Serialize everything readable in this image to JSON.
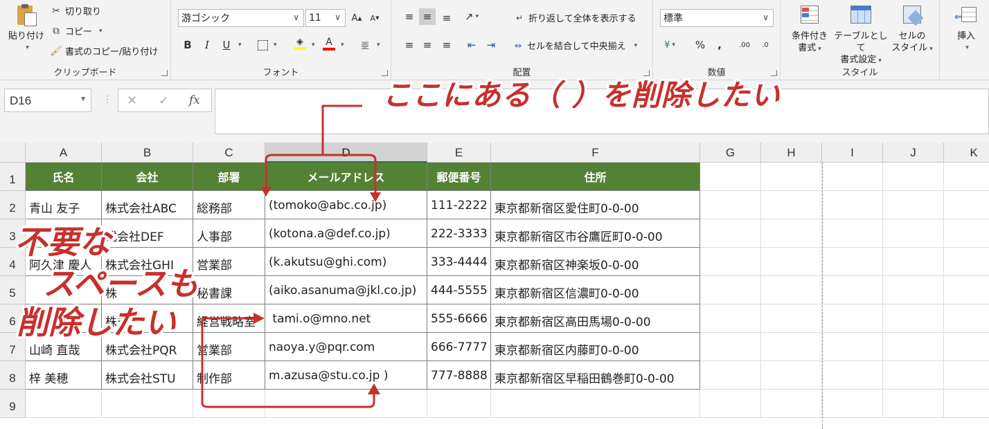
{
  "ribbon": {
    "clipboard": {
      "paste": "貼り付け",
      "cut": "切り取り",
      "copy": "コピー",
      "format_painter": "書式のコピー/貼り付け",
      "label": "クリップボード"
    },
    "font": {
      "name": "游ゴシック",
      "size": "11",
      "label": "フォント"
    },
    "alignment": {
      "wrap_text": "折り返して全体を表示する",
      "merge_center": "セルを結合して中央揃え",
      "label": "配置"
    },
    "number": {
      "format": "標準",
      "label": "数値"
    },
    "styles": {
      "conditional_1": "条件付き",
      "conditional_2": "書式",
      "table_1": "テーブルとして",
      "table_2": "書式設定",
      "cell_1": "セルの",
      "cell_2": "スタイル",
      "label": "スタイル"
    },
    "cells": {
      "insert": "挿入"
    }
  },
  "formula_bar": {
    "name_box": "D16",
    "cancel_glyph": "✕",
    "enter_glyph": "✓",
    "fx": "fx",
    "value": ""
  },
  "columns": [
    "A",
    "B",
    "C",
    "D",
    "E",
    "F",
    "G",
    "H",
    "I",
    "J",
    "K"
  ],
  "rows": [
    "1",
    "2",
    "3",
    "4",
    "5",
    "6",
    "7",
    "8",
    "9"
  ],
  "table": {
    "headers": [
      "氏名",
      "会社",
      "部署",
      "メールアドレス",
      "郵便番号",
      "住所"
    ],
    "rows": [
      [
        "青山 友子",
        "株式会社ABC",
        "総務部",
        "(tomoko@abc.co.jp)",
        "111-2222",
        "東京都新宿区愛住町0-0-00"
      ],
      [
        "",
        "式会社DEF",
        "人事部",
        "(kotona.a@def.co.jp)",
        "222-3333",
        "東京都新宿区市谷鷹匠町0-0-00"
      ],
      [
        "阿久津 慶人",
        "株式会社GHI",
        "営業部",
        "(k.akutsu@ghi.com)",
        "333-4444",
        "東京都新宿区神楽坂0-0-00"
      ],
      [
        "",
        "株",
        "秘書課",
        "(aiko.asanuma@jkl.co.jp)",
        "444-5555",
        "東京都新宿区信濃町0-0-00"
      ],
      [
        "",
        "株式",
        "経営戦略室",
        " tami.o@mno.net",
        "555-6666",
        "東京都新宿区高田馬場0-0-00"
      ],
      [
        "山崎 直哉",
        "株式会社PQR",
        "営業部",
        "naoya.y@pqr.com",
        "666-7777",
        "東京都新宿区内藤町0-0-00"
      ],
      [
        "梓 美穂",
        "株式会社STU",
        "制作部",
        "m.azusa@stu.co.jp )",
        "777-8888",
        "東京都新宿区早稲田鶴巻町0-0-00"
      ]
    ]
  },
  "annotations": {
    "top": "ここにある（ ）を削除したい",
    "left_1": "不要な",
    "left_2": "スペースも",
    "left_3": "削除したい",
    "color": "#c8302c"
  },
  "colors": {
    "header_fill": "#548235",
    "selection_accent": "#217346"
  }
}
